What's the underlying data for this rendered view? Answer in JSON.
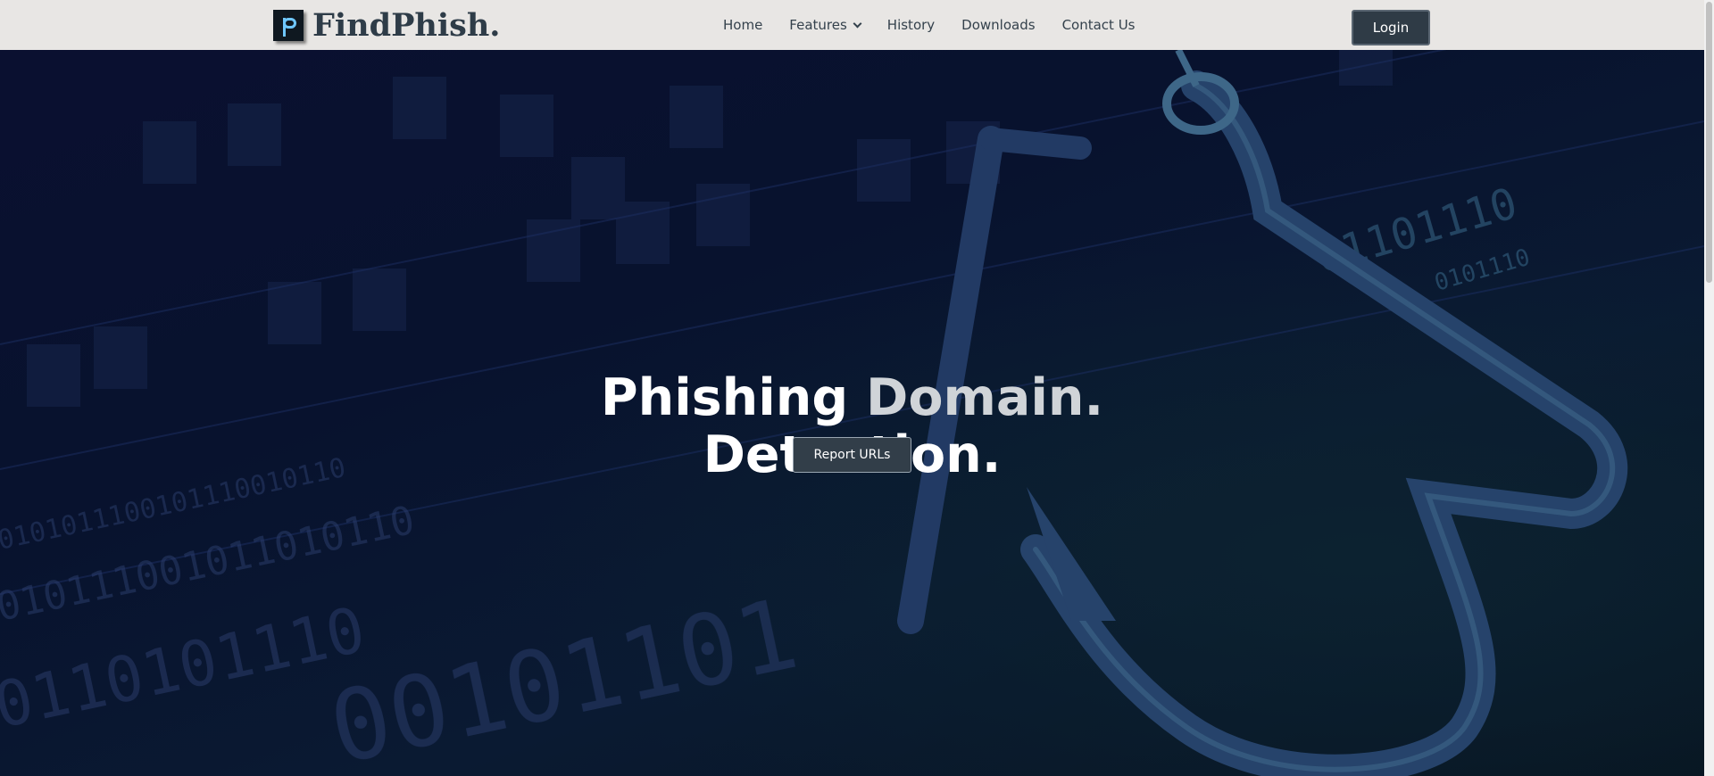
{
  "brand": {
    "name": "FindPhish."
  },
  "nav": {
    "items": [
      {
        "label": "Home"
      },
      {
        "label": "Features"
      },
      {
        "label": "History"
      },
      {
        "label": "Downloads"
      },
      {
        "label": "Contact Us"
      }
    ]
  },
  "header": {
    "login_label": "Login"
  },
  "hero": {
    "title_part1": "Phishing ",
    "title_part2": "Domain.",
    "title_line2": "Detection.",
    "cta_label": "Report URLs",
    "binary_text_1": "0101011100101110010110",
    "binary_text_2": "010111001011010110",
    "binary_text_3": "0110101110",
    "binary_text_4": "00101101",
    "binary_text_5": "01101110",
    "binary_text_6": "0101110"
  },
  "colors": {
    "header_bg": "#e8e6e4",
    "hero_bg": "#0a1030",
    "button_bg": "#2f3b46",
    "accent_text": "#d0d4d8"
  }
}
